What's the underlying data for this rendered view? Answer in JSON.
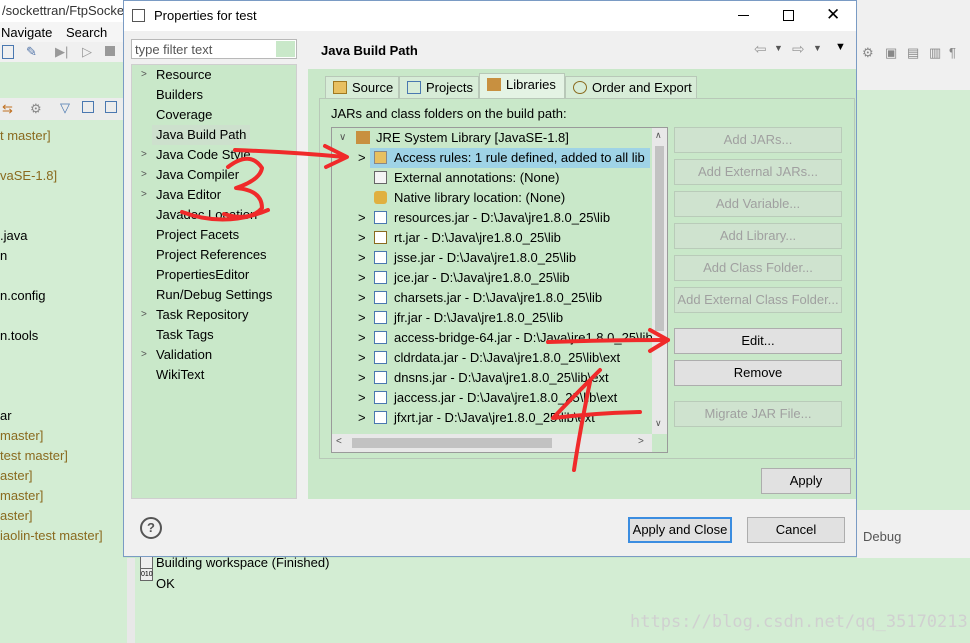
{
  "background": {
    "window_title": "/sockettran/FtpSocke",
    "menu": [
      "Navigate",
      "Search"
    ],
    "left_texts": [
      "t master]",
      "vaSE-1.8]",
      ".java",
      "n",
      "n.config",
      "n.tools",
      "ar",
      "master]",
      "test master]",
      "aster]",
      "master]",
      "aster]",
      "iaolin-test master]"
    ],
    "right_tab": "Debug",
    "console_line1": "Building workspace (Finished)",
    "console_line2": "OK",
    "watermark": "https://blog.csdn.net/qq_35170213"
  },
  "dialog": {
    "title": "Properties for test",
    "filter_placeholder": "type filter text",
    "tree": [
      {
        "label": "Resource",
        "expandable": true
      },
      {
        "label": "Builders",
        "expandable": false
      },
      {
        "label": "Coverage",
        "expandable": false
      },
      {
        "label": "Java Build Path",
        "expandable": false,
        "selected": true
      },
      {
        "label": "Java Code Style",
        "expandable": true
      },
      {
        "label": "Java Compiler",
        "expandable": true
      },
      {
        "label": "Java Editor",
        "expandable": true
      },
      {
        "label": "Javadoc Location",
        "expandable": false
      },
      {
        "label": "Project Facets",
        "expandable": false
      },
      {
        "label": "Project References",
        "expandable": false
      },
      {
        "label": "PropertiesEditor",
        "expandable": false
      },
      {
        "label": "Run/Debug Settings",
        "expandable": false
      },
      {
        "label": "Task Repository",
        "expandable": true
      },
      {
        "label": "Task Tags",
        "expandable": false
      },
      {
        "label": "Validation",
        "expandable": true
      },
      {
        "label": "WikiText",
        "expandable": false
      }
    ],
    "page_title": "Java Build Path",
    "tabs": [
      "Source",
      "Projects",
      "Libraries",
      "Order and Export"
    ],
    "active_tab": "Libraries",
    "list_caption": "JARs and class folders on the build path:",
    "library_root": "JRE System Library [JavaSE-1.8]",
    "library_items": [
      {
        "label": "Access rules: 1 rule defined, added to all lib",
        "icon": "access-rules-icon",
        "arrow": true,
        "selected": true
      },
      {
        "label": "External annotations: (None)",
        "icon": "annotations-icon",
        "arrow": false
      },
      {
        "label": "Native library location: (None)",
        "icon": "native-library-icon",
        "arrow": false
      },
      {
        "label": "resources.jar - D:\\Java\\jre1.8.0_25\\lib",
        "icon": "jar-icon",
        "arrow": true
      },
      {
        "label": "rt.jar - D:\\Java\\jre1.8.0_25\\lib",
        "icon": "jar-icon",
        "arrow": true
      },
      {
        "label": "jsse.jar - D:\\Java\\jre1.8.0_25\\lib",
        "icon": "jar-icon",
        "arrow": true
      },
      {
        "label": "jce.jar - D:\\Java\\jre1.8.0_25\\lib",
        "icon": "jar-icon",
        "arrow": true
      },
      {
        "label": "charsets.jar - D:\\Java\\jre1.8.0_25\\lib",
        "icon": "jar-icon",
        "arrow": true
      },
      {
        "label": "jfr.jar - D:\\Java\\jre1.8.0_25\\lib",
        "icon": "jar-icon",
        "arrow": true
      },
      {
        "label": "access-bridge-64.jar - D:\\Java\\jre1.8.0_25\\lib\\ext",
        "icon": "jar-icon",
        "arrow": true
      },
      {
        "label": "cldrdata.jar - D:\\Java\\jre1.8.0_25\\lib\\ext",
        "icon": "jar-icon",
        "arrow": true
      },
      {
        "label": "dnsns.jar - D:\\Java\\jre1.8.0_25\\lib\\ext",
        "icon": "jar-icon",
        "arrow": true
      },
      {
        "label": "jaccess.jar - D:\\Java\\jre1.8.0_25\\lib\\ext",
        "icon": "jar-icon",
        "arrow": true
      },
      {
        "label": "jfxrt.jar - D:\\Java\\jre1.8.0_25\\lib\\ext",
        "icon": "jar-icon",
        "arrow": true
      }
    ],
    "side_buttons": [
      {
        "label": "Add JARs...",
        "enabled": false
      },
      {
        "label": "Add External JARs...",
        "enabled": false
      },
      {
        "label": "Add Variable...",
        "enabled": false
      },
      {
        "label": "Add Library...",
        "enabled": false
      },
      {
        "label": "Add Class Folder...",
        "enabled": false
      },
      {
        "label": "Add External Class Folder...",
        "enabled": false
      },
      {
        "label": "Edit...",
        "enabled": true
      },
      {
        "label": "Remove",
        "enabled": true
      },
      {
        "label": "Migrate JAR File...",
        "enabled": false
      }
    ],
    "apply": "Apply",
    "apply_close": "Apply and Close",
    "cancel": "Cancel",
    "help": "?"
  },
  "annotations": [
    "3",
    "4"
  ],
  "colors": {
    "accent": "#3b8de0",
    "annotation_red": "#f02a2a",
    "pane_green": "#c9e8c9"
  }
}
